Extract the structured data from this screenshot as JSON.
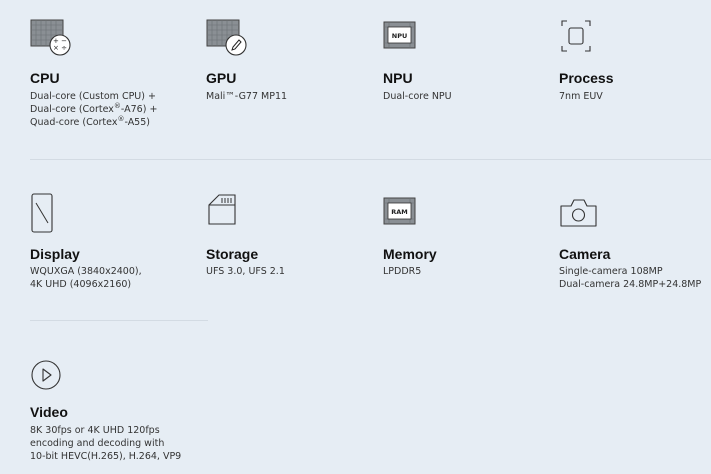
{
  "specs": {
    "cpu": {
      "icon": "cpu-icon",
      "title": "CPU",
      "lines": [
        "Dual-core (Custom CPU) +",
        {
          "pre": "Dual-core (Cortex",
          "sup": "®",
          "post": "-A76) +"
        },
        {
          "pre": "Quad-core (Cortex",
          "sup": "®",
          "post": "-A55)"
        }
      ]
    },
    "gpu": {
      "icon": "gpu-icon",
      "title": "GPU",
      "lines": [
        "Mali™-G77 MP11"
      ]
    },
    "npu": {
      "icon": "npu-icon",
      "icon_label": "NPU",
      "title": "NPU",
      "lines": [
        "Dual-core NPU"
      ]
    },
    "process": {
      "icon": "process-icon",
      "title": "Process",
      "lines": [
        "7nm EUV"
      ]
    },
    "display": {
      "icon": "display-icon",
      "title": "Display",
      "lines": [
        "WQUXGA (3840x2400),",
        "4K UHD (4096x2160)"
      ]
    },
    "storage": {
      "icon": "storage-icon",
      "title": "Storage",
      "lines": [
        "UFS 3.0, UFS 2.1"
      ]
    },
    "memory": {
      "icon": "memory-icon",
      "icon_label": "RAM",
      "title": "Memory",
      "lines": [
        "LPDDR5"
      ]
    },
    "camera": {
      "icon": "camera-icon",
      "title": "Camera",
      "lines": [
        "Single-camera 108MP",
        "Dual-camera 24.8MP+24.8MP"
      ]
    },
    "video": {
      "icon": "play-icon",
      "title": "Video",
      "lines": [
        "8K 30fps or 4K UHD 120fps",
        "encoding and decoding with",
        "10-bit HEVC(H.265), H.264, VP9"
      ]
    }
  },
  "colors": {
    "background": "#e6edf4",
    "chip_fill": "#8a8f94",
    "divider": "#d3dbe3",
    "text": "#1a1a1a"
  }
}
